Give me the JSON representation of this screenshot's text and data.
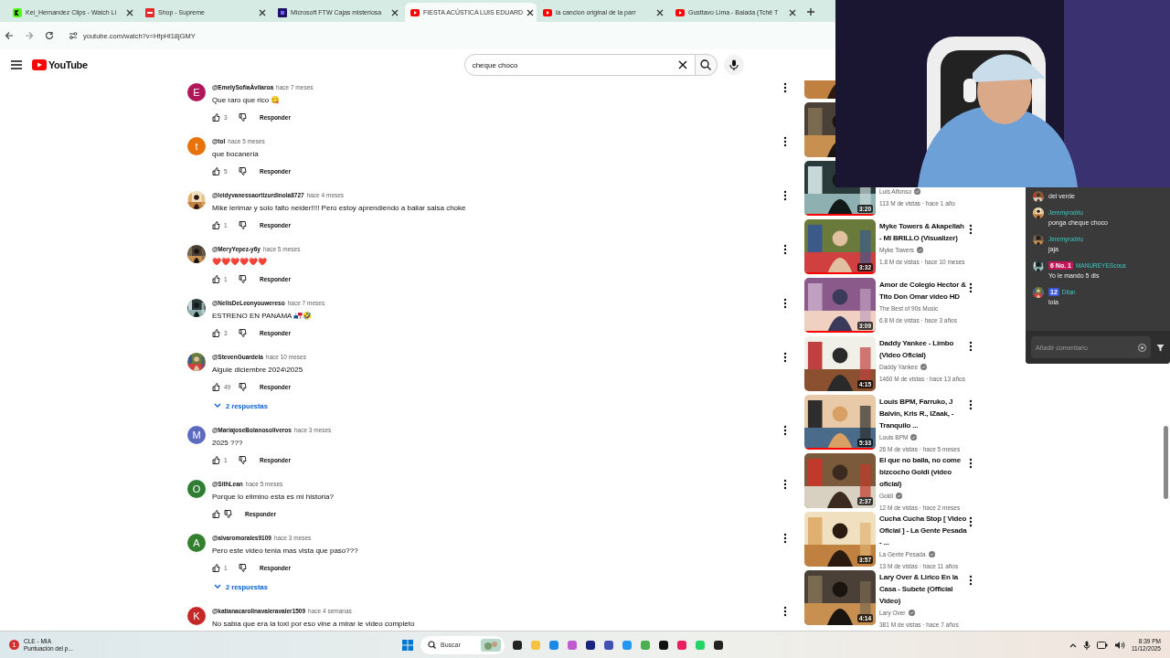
{
  "browser": {
    "tabs": [
      {
        "title": "Kei_Hernandez Clips - Watch Li",
        "kind": "kick",
        "selected": false
      },
      {
        "title": "Shop - Supreme",
        "kind": "supreme",
        "selected": false
      },
      {
        "title": "Microsoft FTW Cajas misteriosa",
        "kind": "microsoft",
        "selected": false
      },
      {
        "title": "FIESTA ACÚSTICA LUIS EDUARD",
        "kind": "youtube",
        "selected": true
      },
      {
        "title": "la cancion original de la parr",
        "kind": "youtube",
        "selected": false
      },
      {
        "title": "Gusttavo Lima - Balada (Tchê T",
        "kind": "youtube",
        "selected": false
      }
    ],
    "address": "youtube.com/watch?v=HfpHl18jGMY"
  },
  "header": {
    "logo_text": "YouTube",
    "search": {
      "value": "cheque choco"
    }
  },
  "comments": [
    {
      "author": "@EmelySofiaÁvilaroa",
      "time": "hace 7 meses",
      "text": "Que raro que rico 😋",
      "likes": "3",
      "reply_button": "Responder",
      "avatar": {
        "kind": "letter",
        "letter": "E",
        "color": "#b0175b"
      }
    },
    {
      "author": "@tol",
      "time": "hace 5 meses",
      "text": "que bocaneria",
      "likes": "5",
      "reply_button": "Responder",
      "avatar": {
        "kind": "letter",
        "letter": "t",
        "color": "#e8710a"
      }
    },
    {
      "author": "@leidyvanessaortizurdinola8727",
      "time": "hace 4 meses",
      "text": "Mike lerimar y solo falto neider!!!! Pero estoy aprendiendo a bailar salsa choke",
      "likes": "1",
      "reply_button": "Responder",
      "avatar": {
        "kind": "picture"
      }
    },
    {
      "author": "@MeryYepez-y6y",
      "time": "hace 5 meses",
      "text": "❤️❤️❤️❤️❤️❤️",
      "likes": "1",
      "reply_button": "Responder",
      "avatar": {
        "kind": "picture"
      }
    },
    {
      "author": "@NelisDeLeonyouwereso",
      "time": "hace 7 meses",
      "text": "ESTRENO EN PANAMA 🇵🇦🤣",
      "likes": "3",
      "reply_button": "Responder",
      "avatar": {
        "kind": "picture"
      }
    },
    {
      "author": "@StevenGuardela",
      "time": "hace 10 meses",
      "text": "Alguie  diciembre 2024\\2025",
      "likes": "49",
      "reply_button": "Responder",
      "replies": "2 respuestas",
      "avatar": {
        "kind": "picture"
      }
    },
    {
      "author": "@MariajoseBolanosoliveros",
      "time": "hace 3 meses",
      "text": "2025 ???",
      "likes": "1",
      "reply_button": "Responder",
      "avatar": {
        "kind": "letter",
        "letter": "M",
        "color": "#5c6bc0"
      }
    },
    {
      "author": "@SithLean",
      "time": "hace 5 meses",
      "text": "Porque lo elimino esta es mi historia?",
      "reply_button": "Responder",
      "avatar": {
        "kind": "letter",
        "letter": "O",
        "color": "#2e7d32"
      }
    },
    {
      "author": "@alvaromorales9109",
      "time": "hace 3 meses",
      "text": "Pero este video tenia mas vista que paso???",
      "likes": "1",
      "reply_button": "Responder",
      "replies": "2 respuestas",
      "avatar": {
        "kind": "letter",
        "letter": "A",
        "color": "#33802f"
      }
    },
    {
      "author": "@katianacarolinavaleravaler1509",
      "time": "hace 4 semanas",
      "text": "No sabia que era la toxi por eso vine a mirar le video completo",
      "avatar": {
        "kind": "letter",
        "letter": "K",
        "color": "#c62828"
      }
    }
  ],
  "recommended": [
    {
      "kind": "picture"
    },
    {
      "kind": "picture"
    },
    {
      "kind": "video",
      "duration": "3:20",
      "channel": "Luis Alfonso",
      "verified": true,
      "views": "113 M de vistas · hace 1 año",
      "watched": {
        "level": 1
      }
    },
    {
      "kind": "video",
      "duration": "3:32",
      "title": "Myke Towers & Akapellah - MI BRILLO (Visualizer)",
      "channel": "Myke Towers",
      "verified": true,
      "views": "1.8 M de vistas · hace 10 meses",
      "watched": {
        "level": 1
      }
    },
    {
      "kind": "video",
      "duration": "3:09",
      "title": "Amor de Colegio Hector & Tito Don Omar video HD",
      "channel": "The Best of 90s Music",
      "verified": false,
      "views": "6.8 M de vistas · hace 3 años",
      "watched": {
        "level": 1
      }
    },
    {
      "kind": "video",
      "duration": "4:15",
      "title": "Daddy Yankee - Limbo (Video Oficial)",
      "channel": "Daddy Yankee",
      "verified": true,
      "views": "1460 M de vistas · hace 13 años"
    },
    {
      "kind": "video",
      "duration": "5:33",
      "title": "Louis BPM, Farruko, J Balvin, Kris R., IZaak,  - Tranquilo ...",
      "channel": "Louis BPM",
      "verified": true,
      "views": "26 M de vistas · hace 5 meses",
      "watched": {
        "level": 1
      }
    },
    {
      "kind": "video",
      "duration": "2:37",
      "title": "El que  no baila, no come bizcocho Goldi (video oficial)",
      "channel": "Goldi",
      "verified": true,
      "views": "12 M de vistas · hace 2 meses"
    },
    {
      "kind": "video",
      "duration": "3:57",
      "title": "Cucha Cucha Stop [ Video Oficial ] - La Gente Pesada - ...",
      "channel": "La Gente Pesada",
      "verified": true,
      "views": "13 M de vistas · hace 11 años"
    },
    {
      "kind": "video",
      "duration": "4:14",
      "title": "Lary Over & Lirico En la Casa - Subete (Official Video)",
      "channel": "Lary Over",
      "verified": true,
      "views": "381 M de vistas · hace 7 años"
    }
  ],
  "stream_chat": {
    "messages": [
      {
        "text": "del verde"
      },
      {
        "user": "Jeremyrodriu",
        "text": "ponga cheque choco"
      },
      {
        "user": "Jeremyrodriu",
        "text": "jaja"
      },
      {
        "user": "MANUREYEScous",
        "badges": [
          {
            "text": "6 No. 1",
            "color": "#c2185b"
          }
        ],
        "text": "Yo le mando 5 dls"
      },
      {
        "user": "Dilan",
        "badges": [
          {
            "text": "12",
            "color": "#3b5bdb"
          }
        ],
        "text": "lola"
      }
    ],
    "placeholder": "Añadir comentario"
  },
  "taskbar": {
    "notification": {
      "badge": "1",
      "title": "CLE - MIA",
      "subtitle": "Puntuación del p..."
    },
    "search_placeholder": "Buscar",
    "time": "8:39 PM",
    "date": "11/12/2025"
  }
}
